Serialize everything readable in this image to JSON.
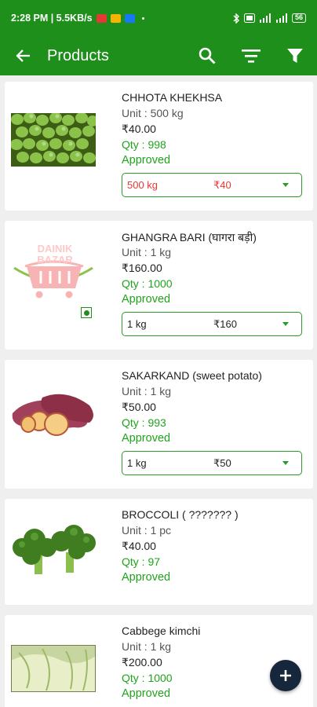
{
  "status_bar": {
    "time_net": "2:28 PM | 5.5KB/s",
    "battery": "56"
  },
  "app_bar": {
    "title": "Products",
    "back_icon": "arrow-left-icon",
    "search_icon": "search-icon",
    "sort_icon": "sort-icon",
    "filter_icon": "filter-icon"
  },
  "colors": {
    "primary": "#1e8f1b",
    "accent_green": "#1fa31c",
    "price_red": "#e53935",
    "fab": "#16263b"
  },
  "products": [
    {
      "name": "CHHOTA KHEKHSA",
      "unit": "Unit : 500 kg",
      "price": "₹40.00",
      "qty": "Qty : 998",
      "status": "Approved",
      "variant_unit": "500 kg",
      "variant_price": "₹40"
    },
    {
      "name": "GHANGRA BARI (घागरा बड़ी)",
      "unit": "Unit : 1 kg",
      "price": "₹160.00",
      "qty": "Qty : 1000",
      "status": "Approved",
      "variant_unit": "1 kg",
      "variant_price": "₹160"
    },
    {
      "name": "SAKARKAND (sweet potato)",
      "unit": "Unit : 1 kg",
      "price": "₹50.00",
      "qty": "Qty : 993",
      "status": "Approved",
      "variant_unit": "1 kg",
      "variant_price": "₹50"
    },
    {
      "name": "BROCCOLI ( ??????? )",
      "unit": "Unit : 1 pc",
      "price": "₹40.00",
      "qty": "Qty : 97",
      "status": "Approved"
    },
    {
      "name": "Cabbege kimchi",
      "unit": "Unit : 1 kg",
      "price": "₹200.00",
      "qty": "Qty : 1000",
      "status": "Approved"
    }
  ],
  "placeholder_logo": {
    "line1": "DAINIK",
    "line2": "BAZAR"
  },
  "fab_icon": "plus-icon"
}
